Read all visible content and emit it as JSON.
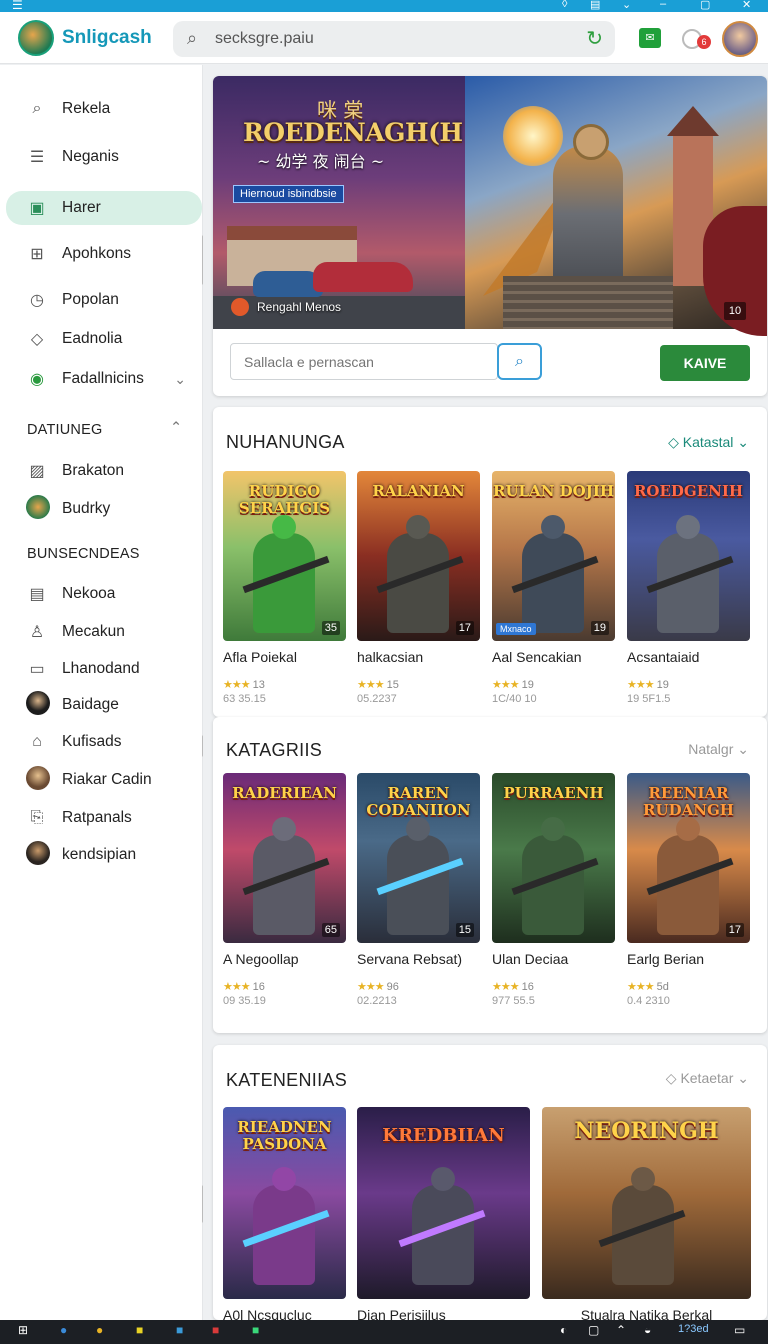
{
  "header": {
    "brand": "Snligcash",
    "search_value": "secksgre.paiu",
    "notification_count": "6"
  },
  "sidebar": {
    "items": [
      {
        "label": "Rekela",
        "icon": "search-icon"
      },
      {
        "label": "Neganis",
        "icon": "list-icon"
      },
      {
        "label": "Harer",
        "icon": "calendar-icon",
        "active": true
      },
      {
        "label": "Apohkons",
        "icon": "grid-icon"
      },
      {
        "label": "Popolan",
        "icon": "clock-icon"
      },
      {
        "label": "Eadnolia",
        "icon": "tag-icon"
      },
      {
        "label": "Fadallnicins",
        "icon": "check-circle-icon"
      }
    ],
    "section1_title": "DATIUNEG",
    "section1_items": [
      {
        "label": "Brakaton",
        "icon": "pattern-icon"
      },
      {
        "label": "Budrky",
        "icon": "game-avatar-icon"
      }
    ],
    "section2_title": "BUNSECNDEAS",
    "section2_items": [
      {
        "label": "Nekooa",
        "icon": "doc-icon"
      },
      {
        "label": "Mecakun",
        "icon": "user-icon"
      },
      {
        "label": "Lhanodand",
        "icon": "folder-icon"
      },
      {
        "label": "Baidage",
        "icon": "avatar-icon"
      },
      {
        "label": "Kufisads",
        "icon": "bag-icon"
      },
      {
        "label": "Riakar Cadin",
        "icon": "avatar-icon"
      },
      {
        "label": "Ratpanals",
        "icon": "gift-icon"
      },
      {
        "label": "kendsipian",
        "icon": "avatar-icon"
      }
    ]
  },
  "hero": {
    "cjk": "咪 棠",
    "title": "ROEDENAGH(H",
    "subtitle": "~ 幼学 夜 闹台 ~",
    "tag": "Hiernoud isbindbsie",
    "note": "Rengahl Menos",
    "count": "10",
    "input_placeholder": "Sallacla e pernascan",
    "go_label": "KAIVE"
  },
  "sections": [
    {
      "title": "NUHANUNGA",
      "link": "Katastal",
      "games": [
        {
          "name": "Afla Poiekal",
          "rating": "13",
          "date": "63 35.15",
          "thumb_title": "RUDIGO SERAHGIS",
          "count": "35"
        },
        {
          "name": "halkacsian",
          "rating": "15",
          "date": "05.2237",
          "thumb_title": "RALANIAN",
          "count": "17"
        },
        {
          "name": "Aal Sencakian",
          "rating": "19",
          "date": "1C/40 10",
          "thumb_title": "RULAN DOJIH",
          "count": "19",
          "pill": "Mxnaco"
        },
        {
          "name": "Acsantaiaid",
          "rating": "19",
          "date": "19 5F1.5",
          "thumb_title": "ROEDGENIH",
          "count": ""
        }
      ]
    },
    {
      "title": "KATAGRIIS",
      "link": "Natalgr",
      "games": [
        {
          "name": "Negoollap",
          "prefix": "A",
          "rating": "16",
          "date": "09 35.19",
          "thumb_title": "RADERIEAN",
          "count": "65"
        },
        {
          "name": "Servana Rebsat)",
          "rating": "96",
          "date": "02.2213",
          "thumb_title": "RAREN CODANIION",
          "count": "15"
        },
        {
          "name": "Ulan Deciaa",
          "rating": "16",
          "date": "977 55.5",
          "thumb_title": "PURRAENH",
          "count": ""
        },
        {
          "name": "Earlg Berian",
          "rating": "5d",
          "date": "0.4 2310",
          "thumb_title": "REENIAR RUDANGH",
          "count": "17"
        }
      ]
    },
    {
      "title": "KATENENIIAS",
      "link": "Ketaetar",
      "games": [
        {
          "name": "A0l Ncsqucluc",
          "thumb_title": "RIEADNEN PASDONA",
          "count": ""
        },
        {
          "name": "Dian Perisiilus",
          "thumb_title": "KREDBIIAN",
          "count": ""
        },
        {
          "name": "Stualra Natika Berkal",
          "thumb_title": "NEORINGH",
          "count": ""
        }
      ]
    }
  ],
  "taskbar": {
    "time": "1?3ed"
  }
}
